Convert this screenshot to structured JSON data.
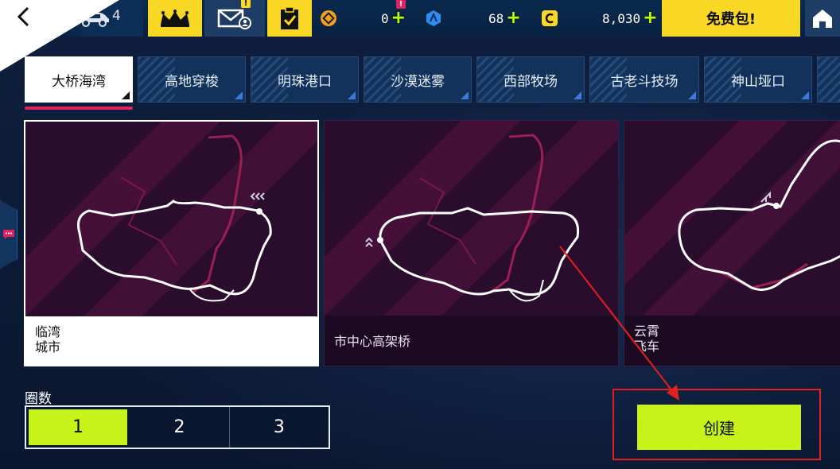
{
  "topbar": {
    "car_count": "4",
    "currencies": [
      {
        "name": "tokens",
        "value": "0",
        "plus": "+",
        "color": "#f0a020"
      },
      {
        "name": "blueprints",
        "value": "68",
        "plus": "+",
        "color": "#2f8cf0"
      },
      {
        "name": "credits",
        "value": "8,030",
        "plus": "+",
        "color": "#f8d824"
      }
    ],
    "free_pack_label": "免费包!",
    "mail_badge": "!",
    "task_badge": "!"
  },
  "tabs": [
    {
      "label": "大桥海湾",
      "active": true
    },
    {
      "label": "高地穿梭",
      "active": false
    },
    {
      "label": "明珠港口",
      "active": false
    },
    {
      "label": "沙漠迷雾",
      "active": false
    },
    {
      "label": "西部牧场",
      "active": false
    },
    {
      "label": "古老斗技场",
      "active": false
    },
    {
      "label": "神山垭口",
      "active": false
    }
  ],
  "tracks": [
    {
      "name_line1": "临湾",
      "name_line2": "城市",
      "selected": true
    },
    {
      "name_line1": "市中心高架桥",
      "name_line2": "",
      "selected": false
    },
    {
      "name_line1": "云霄",
      "name_line2": "飞车",
      "selected": false
    }
  ],
  "laps": {
    "label": "圈数",
    "options": [
      "1",
      "2",
      "3"
    ],
    "selected": "1"
  },
  "create_label": "创建",
  "colors": {
    "accent_green": "#c7f21a",
    "accent_yellow": "#f8d824",
    "annotation_red": "#e32020",
    "tab_underline": "#e0235f"
  }
}
